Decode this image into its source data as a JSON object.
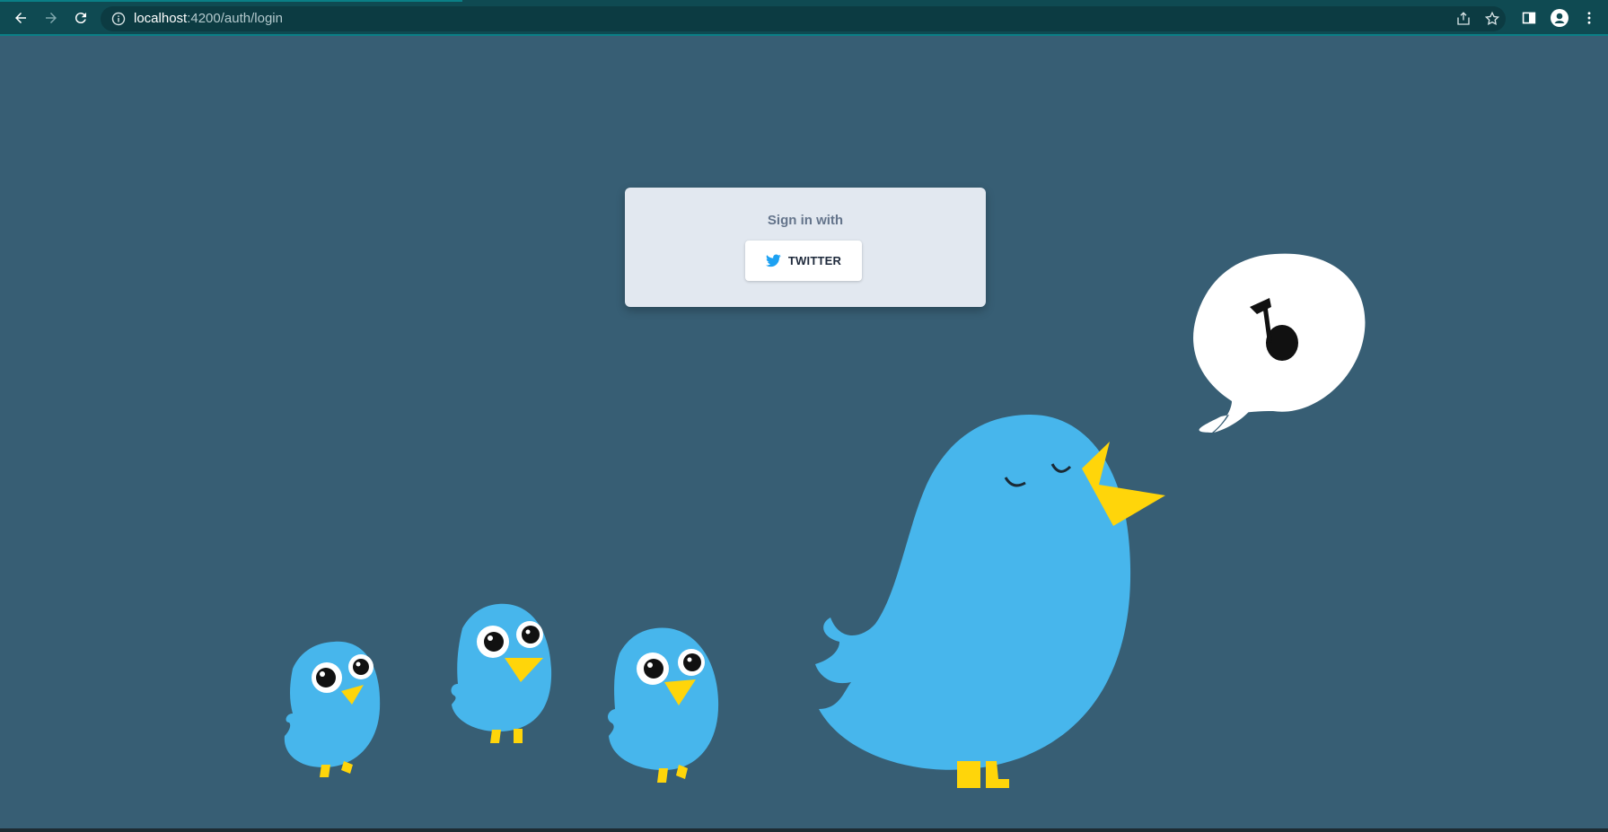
{
  "browser": {
    "url_host": "localhost",
    "url_path": ":4200/auth/login",
    "icons": [
      "back-arrow-icon",
      "forward-arrow-icon",
      "reload-icon",
      "site-info-icon",
      "share-icon",
      "bookmark-star-icon",
      "side-panel-icon",
      "profile-icon",
      "more-menu-icon"
    ]
  },
  "login": {
    "title": "Sign in with",
    "twitter_button_label": "TWITTER",
    "twitter_icon": "twitter-bird-icon"
  },
  "colors": {
    "background": "#375e74",
    "card": "#e2e8f0",
    "twitter_blue": "#1da1f2",
    "bird_blue": "#47b6ec",
    "beak_yellow": "#ffd50a"
  },
  "illustration": {
    "description_icons": [
      "singing-bird-illustration",
      "music-note-speech-bubble",
      "small-bird-illustration"
    ]
  }
}
